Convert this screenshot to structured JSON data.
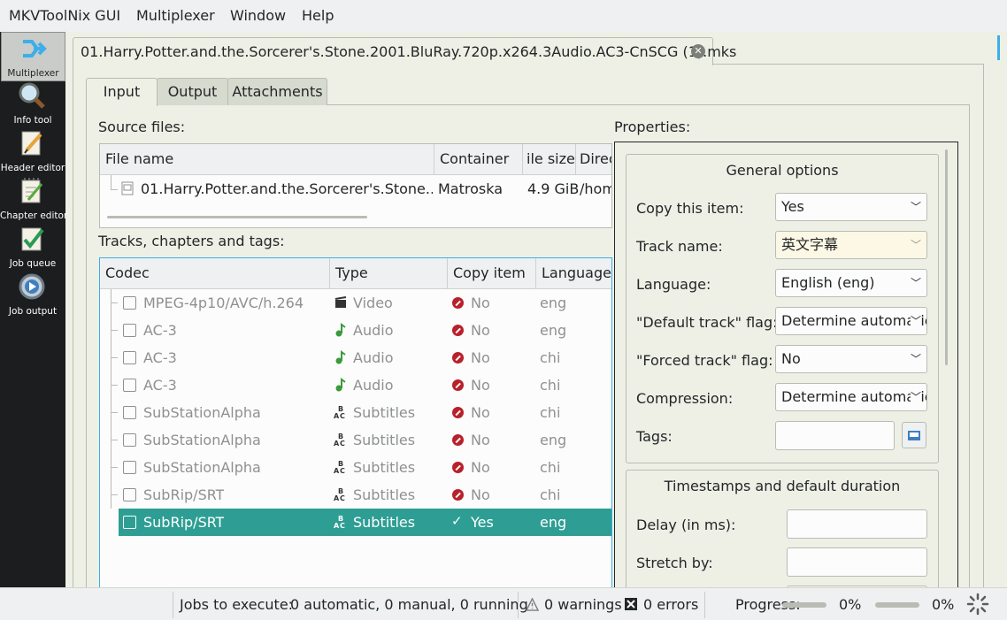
{
  "menubar": {
    "items": [
      "MKVToolNix GUI",
      "Multiplexer",
      "Window",
      "Help"
    ]
  },
  "sidebar": {
    "items": [
      {
        "label": "Multiplexer",
        "icon": "multiplexer-icon",
        "active": true
      },
      {
        "label": "Info tool",
        "icon": "info-tool-icon"
      },
      {
        "label": "Header editor",
        "icon": "header-editor-icon"
      },
      {
        "label": "Chapter editor",
        "icon": "chapter-editor-icon"
      },
      {
        "label": "Job queue",
        "icon": "job-queue-icon"
      },
      {
        "label": "Job output",
        "icon": "job-output-icon"
      }
    ]
  },
  "doc_tab": {
    "title": "01.Harry.Potter.and.the.Sorcerer's.Stone.2001.BluRay.720p.x264.3Audio.AC3-CnSCG (1).mks"
  },
  "inner_tabs": [
    "Input",
    "Output",
    "Attachments"
  ],
  "source_files": {
    "label": "Source files:",
    "columns": [
      "File name",
      "Container",
      "ile size",
      "Direc"
    ],
    "rows": [
      {
        "file": "01.Harry.Potter.and.the.Sorcerer's.Stone....",
        "container": "Matroska",
        "size": "4.9 GiB",
        "dir": "/hom"
      }
    ]
  },
  "tracks": {
    "label": "Tracks, chapters and tags:",
    "columns": [
      "Codec",
      "Type",
      "Copy item",
      "Language"
    ],
    "rows": [
      {
        "codec": "MPEG-4p10/AVC/h.264",
        "type": "Video",
        "copy": "No",
        "lang": "eng"
      },
      {
        "codec": "AC-3",
        "type": "Audio",
        "copy": "No",
        "lang": "eng"
      },
      {
        "codec": "AC-3",
        "type": "Audio",
        "copy": "No",
        "lang": "chi"
      },
      {
        "codec": "AC-3",
        "type": "Audio",
        "copy": "No",
        "lang": "chi"
      },
      {
        "codec": "SubStationAlpha",
        "type": "Subtitles",
        "copy": "No",
        "lang": "chi"
      },
      {
        "codec": "SubStationAlpha",
        "type": "Subtitles",
        "copy": "No",
        "lang": "eng"
      },
      {
        "codec": "SubStationAlpha",
        "type": "Subtitles",
        "copy": "No",
        "lang": "chi"
      },
      {
        "codec": "SubRip/SRT",
        "type": "Subtitles",
        "copy": "No",
        "lang": "chi"
      },
      {
        "codec": "SubRip/SRT",
        "type": "Subtitles",
        "copy": "Yes",
        "lang": "eng",
        "selected": true
      }
    ]
  },
  "properties": {
    "label": "Properties:",
    "general": {
      "title": "General options",
      "copy_item": {
        "label": "Copy this item:",
        "value": "Yes"
      },
      "track_name": {
        "label": "Track name:",
        "value": "英文字幕"
      },
      "language": {
        "label": "Language:",
        "value": "English (eng)"
      },
      "default_flag": {
        "label": "\"Default track\" flag:",
        "value": "Determine automatically"
      },
      "forced_flag": {
        "label": "\"Forced track\" flag:",
        "value": "No"
      },
      "compression": {
        "label": "Compression:",
        "value": "Determine automatically"
      },
      "tags": {
        "label": "Tags:",
        "value": ""
      }
    },
    "timestamps": {
      "title": "Timestamps and default duration",
      "delay": {
        "label": "Delay (in ms):",
        "value": ""
      },
      "stretch": {
        "label": "Stretch by:",
        "value": ""
      }
    }
  },
  "statusbar": {
    "jobs_label": "Jobs to execute:",
    "jobs_value": "0 automatic, 0 manual, 0 running",
    "warnings": "0 warnings",
    "errors": "0 errors",
    "progress_label": "Progress:",
    "progress1": "0%",
    "progress2": "0%"
  },
  "colors": {
    "selection": "#2e9e94",
    "sidebar_bg": "#1b1d1e",
    "accent": "#3daee9"
  }
}
